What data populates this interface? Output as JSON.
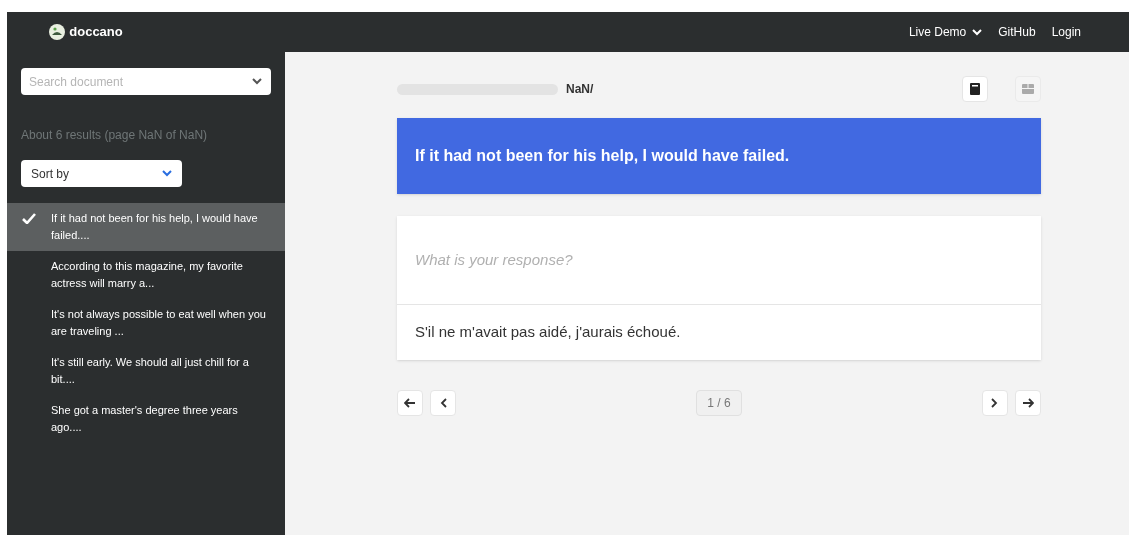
{
  "navbar": {
    "brand": "doccano",
    "links": [
      {
        "label": "Live Demo",
        "dropdown": true
      },
      {
        "label": "GitHub",
        "dropdown": false
      },
      {
        "label": "Login",
        "dropdown": false
      }
    ]
  },
  "sidebar": {
    "search": {
      "placeholder": "Search document"
    },
    "results": "About 6 results (page NaN of NaN)",
    "sort": {
      "value": "Sort by"
    },
    "items": [
      {
        "text": "If it had not been for his help, I would have failed....",
        "selected": true
      },
      {
        "text": "According to this magazine, my favorite actress will marry a...",
        "selected": false
      },
      {
        "text": "It's not always possible to eat well when you are traveling ...",
        "selected": false
      },
      {
        "text": "It's still early. We should all just chill for a bit....",
        "selected": false
      },
      {
        "text": "She got a master's degree three years ago....",
        "selected": false
      }
    ]
  },
  "header": {
    "progress": {
      "level": 0
    },
    "count": "NaN/",
    "tools": [
      {
        "disabled": false
      },
      {
        "disabled": true
      }
    ]
  },
  "source": "If it had not been for his help, I would have failed.",
  "response": {
    "placeholder": "What is your response?",
    "answers": [
      "S'il ne m'avait pas aidé, j'aurais échoué."
    ]
  },
  "pagination": {
    "page": "1 / 6"
  }
}
